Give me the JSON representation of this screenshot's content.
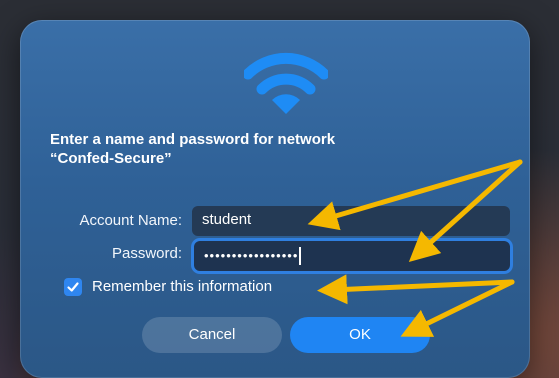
{
  "dialog": {
    "prompt_line1": "Enter a name and password for network",
    "prompt_line2": "“Confed-Secure”",
    "account_label": "Account Name:",
    "account_value": "student",
    "password_label": "Password:",
    "password_masked": "•••••••••••••••••",
    "remember_label": "Remember this information",
    "remember_checked": true,
    "cancel_label": "Cancel",
    "ok_label": "OK"
  },
  "icons": {
    "wifi": "wifi-icon",
    "checkbox": "checkmark-icon",
    "annotation": "arrow-annotation"
  },
  "colors": {
    "accent": "#1f85f3",
    "arrow": "#f5b800",
    "dialog_top": "#3a6fa8",
    "dialog_bottom": "#2b5786"
  }
}
